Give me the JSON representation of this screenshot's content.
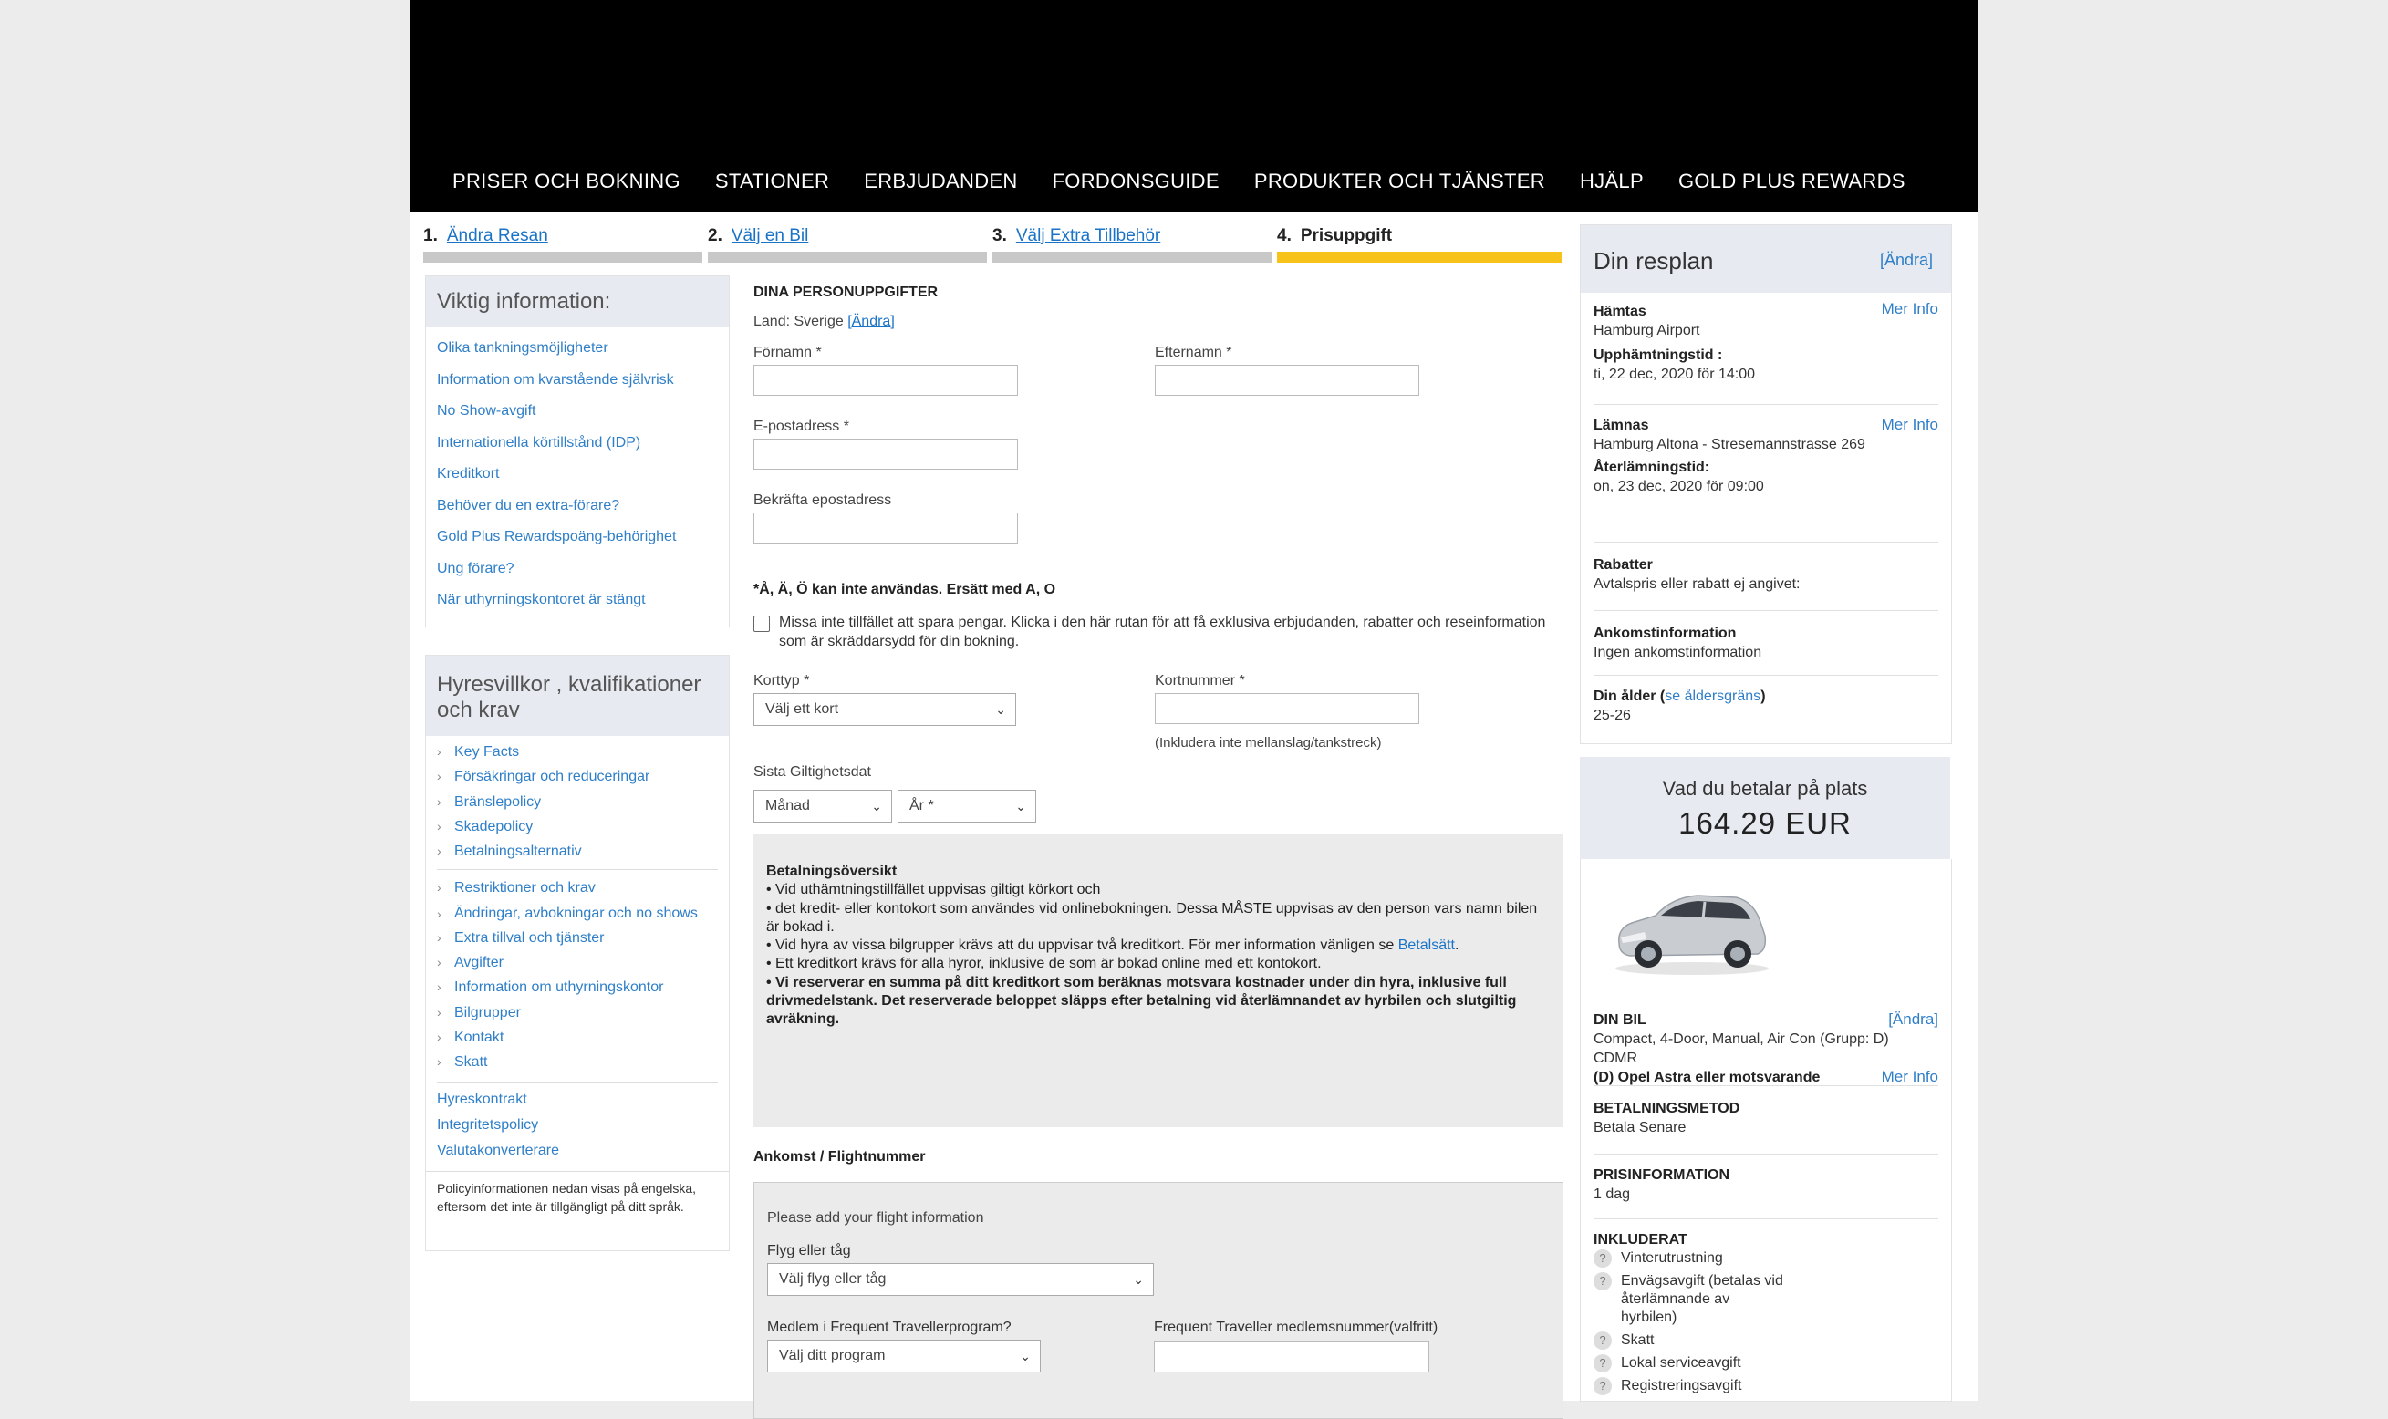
{
  "nav": [
    "PRISER OCH BOKNING",
    "STATIONER",
    "ERBJUDANDEN",
    "FORDONSGUIDE",
    "PRODUKTER OCH TJÄNSTER",
    "HJÄLP",
    "GOLD PLUS REWARDS"
  ],
  "steps": [
    {
      "num": "1.",
      "label": "Ändra Resan"
    },
    {
      "num": "2.",
      "label": "Välj en Bil"
    },
    {
      "num": "3.",
      "label": "Välj Extra Tillbehör"
    },
    {
      "num": "4.",
      "label": "Prisuppgift"
    }
  ],
  "info_box": {
    "title": "Viktig information:",
    "links": [
      "Olika tankningsmöjligheter",
      "Information om kvarstående självrisk",
      "No Show-avgift",
      "Internationella körtillstånd (IDP)",
      "Kreditkort",
      "Behöver du en extra-förare?",
      "Gold Plus Rewardspoäng-behörighet",
      "Ung förare?",
      "När uthyrningskontoret är stängt"
    ]
  },
  "terms_box": {
    "title": "Hyresvillkor , kvalifikationer och krav",
    "items": [
      "Key Facts",
      "Försäkringar och reduceringar",
      "Bränslepolicy",
      "Skadepolicy",
      "Betalningsalternativ",
      "Restriktioner och krav",
      "Ändringar, avbokningar och no shows",
      "Extra tillval och tjänster",
      "Avgifter",
      "Information om uthyrningskontor",
      "Bilgrupper",
      "Kontakt",
      "Skatt"
    ],
    "plain_links": [
      "Hyreskontrakt",
      "Integritetspolicy",
      "Valutakonverterare"
    ],
    "note": "Policyinformationen nedan visas på engelska, eftersom det inte är tillgängligt på ditt språk."
  },
  "form": {
    "section_title": "DINA PERSONUPPGIFTER",
    "country_prefix": "Land: Sverige",
    "country_change": "[Ändra]",
    "first_name": "Förnamn *",
    "last_name": "Efternamn *",
    "email": "E-postadress *",
    "confirm_email": "Bekräfta epostadress",
    "char_note": "*Å, Ä, Ö kan inte användas. Ersätt med A, O",
    "offers_text": "Missa inte tillfället att spara pengar. Klicka i den här rutan för att få exklusiva erbjudanden, rabatter och reseinformation som är skräddarsydd för din bokning.",
    "card_type": "Korttyp *",
    "card_type_value": "Välj ett kort",
    "card_number": "Kortnummer *",
    "card_hint": "(Inkludera inte mellanslag/tankstreck)",
    "expiry": "Sista Giltighetsdat",
    "month_value": "Månad",
    "year_value": "År *"
  },
  "payment": {
    "title": "Betalningsöversikt",
    "b1": "• Vid uthämtningstillfället uppvisas giltigt körkort och",
    "b2": "• det kredit- eller kontokort som användes vid onlinebokningen. Dessa MÅSTE uppvisas av den person vars namn bilen är bokad i.",
    "b3_pre": "• Vid hyra av vissa bilgrupper krävs att du uppvisar två kreditkort. För mer information vänligen se ",
    "b3_link": "Betalsätt",
    "b3_post": ".",
    "b4": "• Ett kreditkort krävs för alla hyror, inklusive de som är bokad online med ett kontokort.",
    "b5": "• Vi reserverar en summa på ditt kreditkort som beräknas motsvara kostnader under din hyra, inklusive full drivmedelstank. Det reserverade beloppet släpps efter betalning vid återlämnandet av hyrbilen och slutgiltig avräkning."
  },
  "flight": {
    "section_title": "Ankomst / Flightnummer",
    "intro": "Please add your flight information",
    "mode_label": "Flyg eller tåg",
    "mode_value": "Välj flyg eller tåg",
    "program_label": "Medlem i Frequent Travellerprogram?",
    "program_value": "Välj ditt program",
    "member_label": "Frequent Traveller medlemsnummer(valfritt)"
  },
  "resplan": {
    "title": "Din resplan",
    "change": "[Ändra]",
    "pickup_label": "Hämtas",
    "pickup_location": "Hamburg Airport",
    "more_info": "Mer Info",
    "pickup_time_label": "Upphämtningstid :",
    "pickup_time": "ti, 22 dec, 2020 för 14:00",
    "return_label": "Lämnas",
    "return_location": "Hamburg Altona - Stresemannstrasse 269",
    "return_time_label": "Återlämningstid:",
    "return_time": "on, 23 dec, 2020 för 09:00",
    "discount_label": "Rabatter",
    "discount_value": "Avtalspris eller rabatt ej angivet:",
    "arrival_label": "Ankomstinformation",
    "arrival_value": "Ingen ankomstinformation",
    "age_label": "Din ålder (",
    "age_link": "se åldersgräns",
    "age_close": ")",
    "age_value": "25-26"
  },
  "onsite": {
    "label": "Vad du betalar på plats",
    "amount": "164.29 EUR"
  },
  "car": {
    "label": "DIN BIL",
    "change": "[Ändra]",
    "desc": "Compact, 4-Door, Manual, Air Con (Grupp: D) CDMR",
    "model": "(D) Opel Astra eller motsvarande",
    "more_info": "Mer Info",
    "pay_label": "BETALNINGSMETOD",
    "pay_value": "Betala Senare",
    "price_label": "PRISINFORMATION",
    "price_value": "1 dag",
    "incl_label": "INKLUDERAT",
    "incl": [
      "Vinterutrustning",
      "Envägsavgift (betalas vid återlämnande av hyrbilen)",
      "Skatt",
      "Lokal serviceavgift",
      "Registreringsavgift"
    ]
  }
}
